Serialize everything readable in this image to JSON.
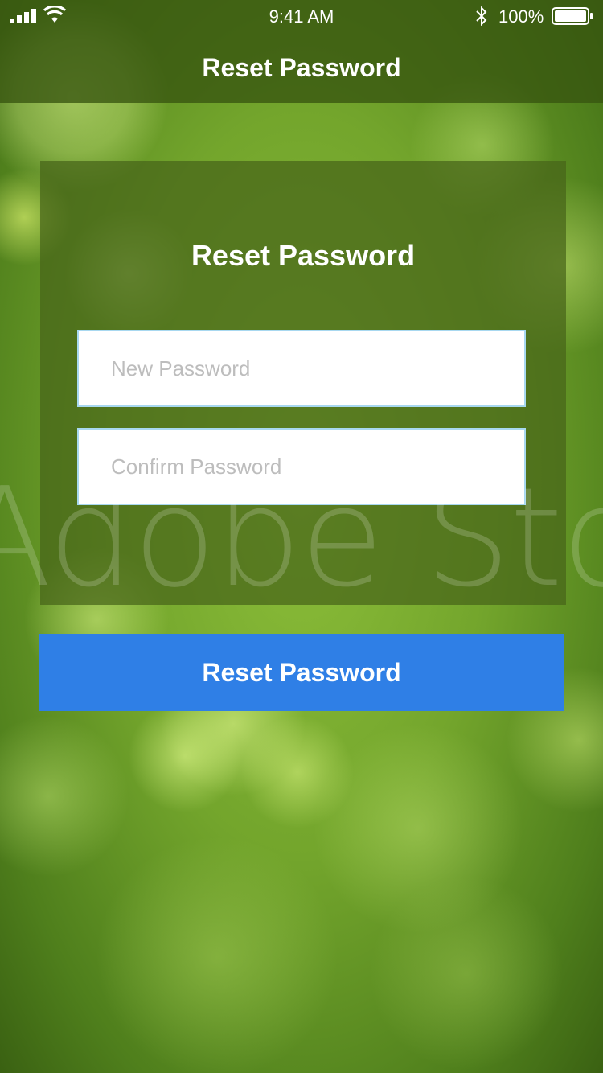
{
  "status_bar": {
    "time": "9:41 AM",
    "battery_percent": "100%",
    "icons": [
      "signal-icon",
      "wifi-icon",
      "bluetooth-icon",
      "battery-icon"
    ],
    "battery_level": 1.0
  },
  "nav": {
    "title": "Reset Password"
  },
  "form": {
    "title": "Reset Password",
    "new_password": {
      "value": "",
      "placeholder": "New Password"
    },
    "confirm_password": {
      "value": "",
      "placeholder": "Confirm Password"
    },
    "submit_label": "Reset Password"
  },
  "watermark": "Adobe Stock",
  "colors": {
    "background": "#7fae2e",
    "nav_overlay": "#37550f",
    "card_overlay": "#466419",
    "button": "#2f7fe6",
    "field_border": "#a8d8f0",
    "placeholder": "#bdbdbd"
  }
}
